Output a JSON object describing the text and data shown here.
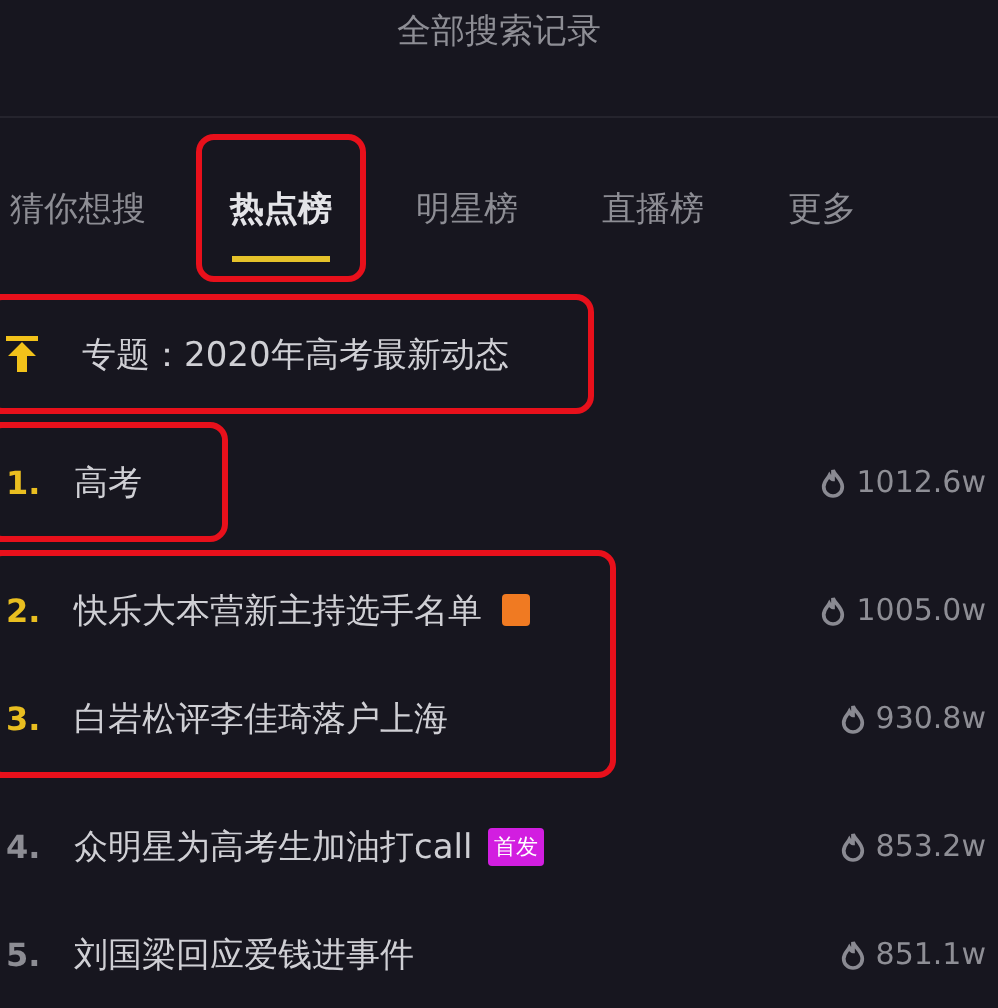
{
  "header": {
    "title": "全部搜索记录"
  },
  "tabs": [
    {
      "label": "猜你想搜",
      "selected": false,
      "annotated": false
    },
    {
      "label": "热点榜",
      "selected": true,
      "annotated": true
    },
    {
      "label": "明星榜",
      "selected": false,
      "annotated": false
    },
    {
      "label": "直播榜",
      "selected": false,
      "annotated": false
    },
    {
      "label": "更多",
      "selected": false,
      "annotated": false
    }
  ],
  "hot_list": [
    {
      "annotated": true,
      "rows": [
        {
          "kind": "pinned",
          "title": "专题：2020年高考最新动态"
        }
      ]
    },
    {
      "annotated": true,
      "rows": [
        {
          "kind": "ranked",
          "rank": "1.",
          "top": true,
          "title": "高考",
          "heat": "1012.6w"
        }
      ]
    },
    {
      "annotated": true,
      "rows": [
        {
          "kind": "ranked",
          "rank": "2.",
          "top": true,
          "title": "快乐大本营新主持选手名单",
          "badge": {
            "color": "#f07a22"
          },
          "heat": "1005.0w"
        },
        {
          "kind": "ranked",
          "rank": "3.",
          "top": true,
          "title": "白岩松评李佳琦落户上海",
          "heat": "930.8w"
        }
      ]
    },
    {
      "annotated": false,
      "rows": [
        {
          "kind": "ranked",
          "rank": "4.",
          "top": false,
          "title": "众明星为高考生加油打call",
          "badge": {
            "color": "#d21ee0",
            "label": "首发"
          },
          "heat": "853.2w"
        },
        {
          "kind": "ranked",
          "rank": "5.",
          "top": false,
          "title": "刘国梁回应爱钱进事件",
          "heat": "851.1w"
        }
      ]
    }
  ]
}
